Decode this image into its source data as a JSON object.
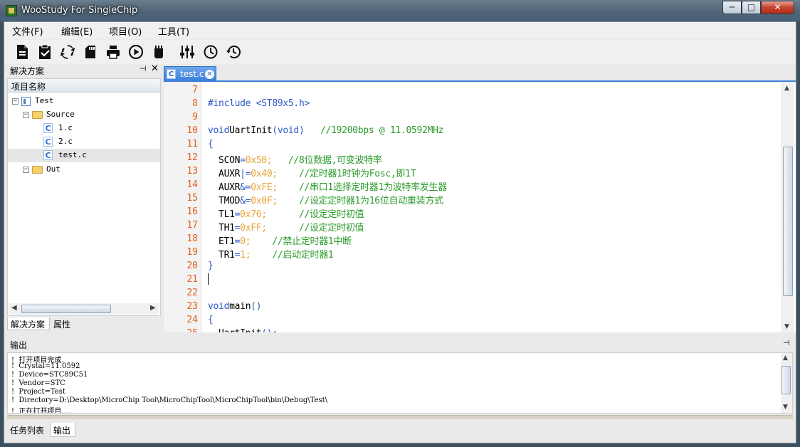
{
  "window": {
    "title": "WooStudy For SingleChip",
    "min": "─",
    "max": "□",
    "close": "✕"
  },
  "menu": [
    "文件(F)",
    "编辑(E)",
    "项目(O)",
    "工具(T)"
  ],
  "toolbar": [
    "new-file-icon",
    "checklist-icon",
    "refresh-icon",
    "sd-card-icon",
    "print-icon",
    "play-icon",
    "chip-icon",
    "settings-sliders-icon",
    "clock-icon",
    "history-icon"
  ],
  "solution": {
    "title": "解决方案",
    "pin": "⊣",
    "close": "✕",
    "column_header": "项目名称",
    "tree": [
      {
        "label": "Test",
        "icon": "project-icon",
        "level": 0,
        "expander": "−"
      },
      {
        "label": "Source",
        "icon": "folder-icon",
        "level": 1,
        "expander": "−"
      },
      {
        "label": "1.c",
        "icon": "c-file-icon",
        "level": 2
      },
      {
        "label": "2.c",
        "icon": "c-file-icon",
        "level": 2
      },
      {
        "label": "test.c",
        "icon": "c-file-icon",
        "level": 2,
        "selected": true
      },
      {
        "label": "Out",
        "icon": "folder-icon",
        "level": 1,
        "expander": "−"
      }
    ],
    "tabs": [
      "解决方案",
      "属性"
    ]
  },
  "editor": {
    "tab": {
      "label": "test.c",
      "icon_letter": "C",
      "close": "✕"
    },
    "line_numbers": [
      "7",
      "8",
      "9",
      "10",
      "11",
      "12",
      "13",
      "14",
      "15",
      "16",
      "17",
      "18",
      "19",
      "20",
      "21",
      "22",
      "23",
      "24",
      "25"
    ],
    "lines": [
      [],
      [
        {
          "t": "#include ",
          "c": "kw"
        },
        {
          "t": "<ST89x5.h>",
          "c": "str"
        }
      ],
      [],
      [
        {
          "t": "void",
          "c": "kw"
        },
        {
          "t": "UartInit",
          "c": "id"
        },
        {
          "t": "(void)",
          "c": "kw"
        },
        {
          "t": "   //19200bps @ 11.0592MHz",
          "c": "cm"
        }
      ],
      [
        {
          "t": "{",
          "c": "kw"
        }
      ],
      [
        {
          "t": "  SCON",
          "c": "id"
        },
        {
          "t": "=",
          "c": "kw"
        },
        {
          "t": "0x50;",
          "c": "num"
        },
        {
          "t": "   //8位数据,可变波特率",
          "c": "cm"
        }
      ],
      [
        {
          "t": "  AUXR",
          "c": "id"
        },
        {
          "t": "|=",
          "c": "kw"
        },
        {
          "t": "0x40;",
          "c": "num"
        },
        {
          "t": "    //定时器1时钟为Fosc,即1T",
          "c": "cm"
        }
      ],
      [
        {
          "t": "  AUXR",
          "c": "id"
        },
        {
          "t": "&=",
          "c": "kw"
        },
        {
          "t": "0xFE;",
          "c": "num"
        },
        {
          "t": "    //串口1选择定时器1为波特率发生器",
          "c": "cm"
        }
      ],
      [
        {
          "t": "  TMOD",
          "c": "id"
        },
        {
          "t": "&=",
          "c": "kw"
        },
        {
          "t": "0x0F;",
          "c": "num"
        },
        {
          "t": "    //设定定时器1为16位自动重装方式",
          "c": "cm"
        }
      ],
      [
        {
          "t": "  TL1",
          "c": "id"
        },
        {
          "t": "=",
          "c": "kw"
        },
        {
          "t": "0x70;",
          "c": "num"
        },
        {
          "t": "      //设定定时初值",
          "c": "cm"
        }
      ],
      [
        {
          "t": "  TH1",
          "c": "id"
        },
        {
          "t": "=",
          "c": "kw"
        },
        {
          "t": "0xFF;",
          "c": "num"
        },
        {
          "t": "      //设定定时初值",
          "c": "cm"
        }
      ],
      [
        {
          "t": "  ET1",
          "c": "id"
        },
        {
          "t": "=",
          "c": "kw"
        },
        {
          "t": "0;",
          "c": "num"
        },
        {
          "t": "    //禁止定时器1中断",
          "c": "cm"
        }
      ],
      [
        {
          "t": "  TR1",
          "c": "id"
        },
        {
          "t": "=",
          "c": "kw"
        },
        {
          "t": "1;",
          "c": "num"
        },
        {
          "t": "    //启动定时器1",
          "c": "cm"
        }
      ],
      [
        {
          "t": "}",
          "c": "kw"
        }
      ],
      [],
      [],
      [
        {
          "t": "void",
          "c": "kw"
        },
        {
          "t": "main",
          "c": "id"
        },
        {
          "t": "()",
          "c": "kw"
        }
      ],
      [
        {
          "t": "{",
          "c": "kw"
        }
      ],
      [
        {
          "t": "  UartInit",
          "c": "id"
        },
        {
          "t": "();",
          "c": "kw"
        }
      ]
    ]
  },
  "output": {
    "title": "输出",
    "pin": "⊣",
    "lines": [
      "!  打开项目完成.",
      "!  Crystal=11.0592",
      "!  Device=STC89C51",
      "!  Vendor=STC",
      "!  Project=Test",
      "!  Directory=D:\\Desktop\\MicroChip Tool\\MicroChipTool\\MicroChipTool\\bin\\Debug\\Test\\",
      "!  正在打开项目...."
    ]
  },
  "bottom_tabs": [
    "任务列表",
    "输出"
  ]
}
